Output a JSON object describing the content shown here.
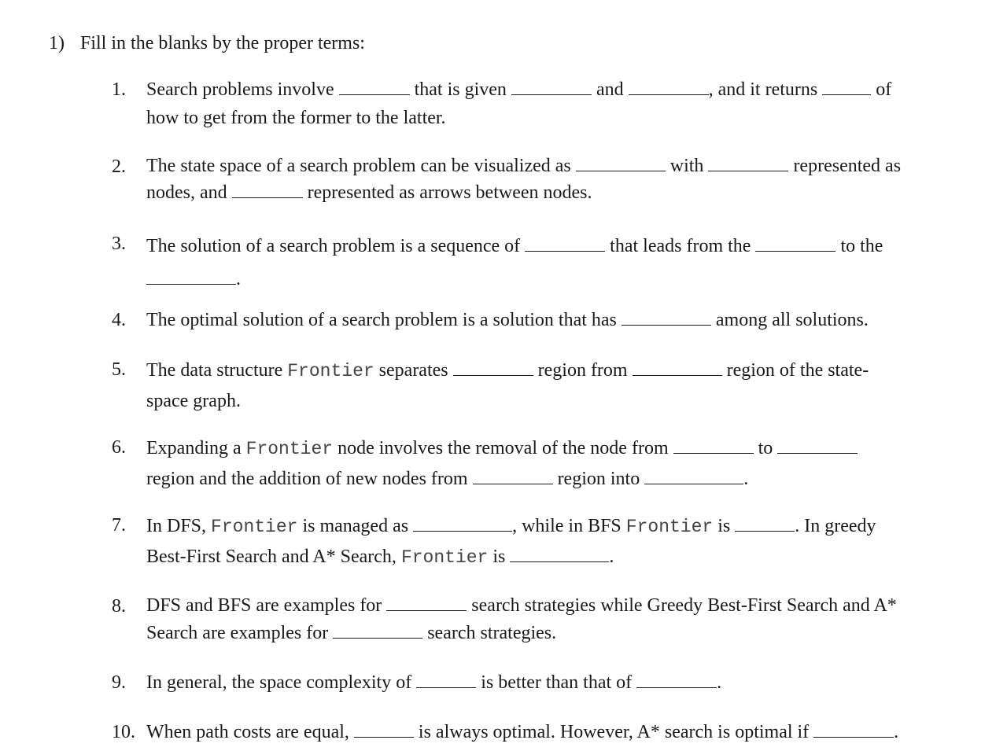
{
  "heading": {
    "number": "1)",
    "text": "Fill in the blanks by the proper terms:"
  },
  "items": [
    {
      "number": "1.",
      "parts": [
        "Search problems involve",
        "that is given",
        "and",
        ", and it returns",
        "of",
        "how to get from the former to the latter."
      ]
    },
    {
      "number": "2.",
      "parts": [
        "The state space of a search problem can be visualized as",
        "with",
        "represented as",
        "nodes, and",
        "represented as arrows between nodes."
      ]
    },
    {
      "number": "3.",
      "parts": [
        "The solution of a search problem is a sequence of",
        "that leads from the",
        "to the",
        "."
      ]
    },
    {
      "number": "4.",
      "parts": [
        "The optimal solution of a search problem is a solution that has",
        "among all solutions."
      ]
    },
    {
      "number": "5.",
      "parts": [
        "The data structure",
        "Frontier",
        "separates",
        "region from",
        "region of the state-",
        "space graph."
      ]
    },
    {
      "number": "6.",
      "parts": [
        "Expanding a",
        "Frontier",
        "node involves the removal of the node from",
        "to",
        "region and the addition of new nodes from",
        "region into",
        "."
      ]
    },
    {
      "number": "7.",
      "parts": [
        "In DFS,",
        "Frontier",
        "is managed as",
        ", while in BFS",
        "Frontier",
        "is",
        ". In greedy",
        "Best-First Search and A* Search,",
        "Frontier",
        "is",
        "."
      ]
    },
    {
      "number": "8.",
      "parts": [
        "DFS and BFS are examples for",
        "search strategies while Greedy Best-First Search and A*",
        "Search are examples for",
        "search strategies."
      ]
    },
    {
      "number": "9.",
      "parts": [
        "In general, the space complexity of",
        "is better than that of",
        "."
      ]
    },
    {
      "number": "10.",
      "parts": [
        "When path costs are equal,",
        "is always optimal. However, A* search is optimal if",
        "."
      ]
    }
  ]
}
